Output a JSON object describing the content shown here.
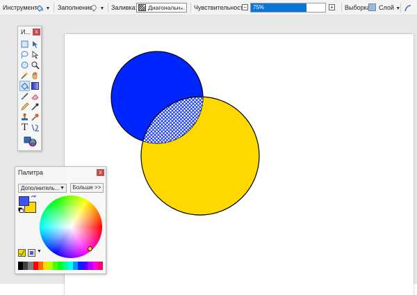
{
  "toolbar": {
    "tool_label": "Инструмент:",
    "fillmode_label": "Заполнение:",
    "fill_label": "Заливка:",
    "fill_value": "Диагональн...",
    "sensitivity_label": "Чувствительность:",
    "sensitivity_text": "75%",
    "sensitivity_percent": 75,
    "selection_label": "Выборка:",
    "selection_value": "Слой"
  },
  "tools_window": {
    "title": "И..."
  },
  "palette_window": {
    "title": "Палитра",
    "mode_value": "Дополнитель...",
    "more_button": "Больше >>",
    "primary_color": "#3a52ff",
    "secondary_color": "#ffd800",
    "swatches": [
      "#000000",
      "#404040",
      "#808080",
      "#ff0000",
      "#ff6a00",
      "#ffd800",
      "#b6ff00",
      "#4cff00",
      "#00ff21",
      "#00ff90",
      "#00ffff",
      "#0094ff",
      "#0026ff",
      "#4800ff",
      "#b200ff",
      "#ff00dc",
      "#ff006e"
    ]
  },
  "canvas": {
    "blue_circle_color": "#0026ff",
    "yellow_circle_color": "#ffd800"
  }
}
